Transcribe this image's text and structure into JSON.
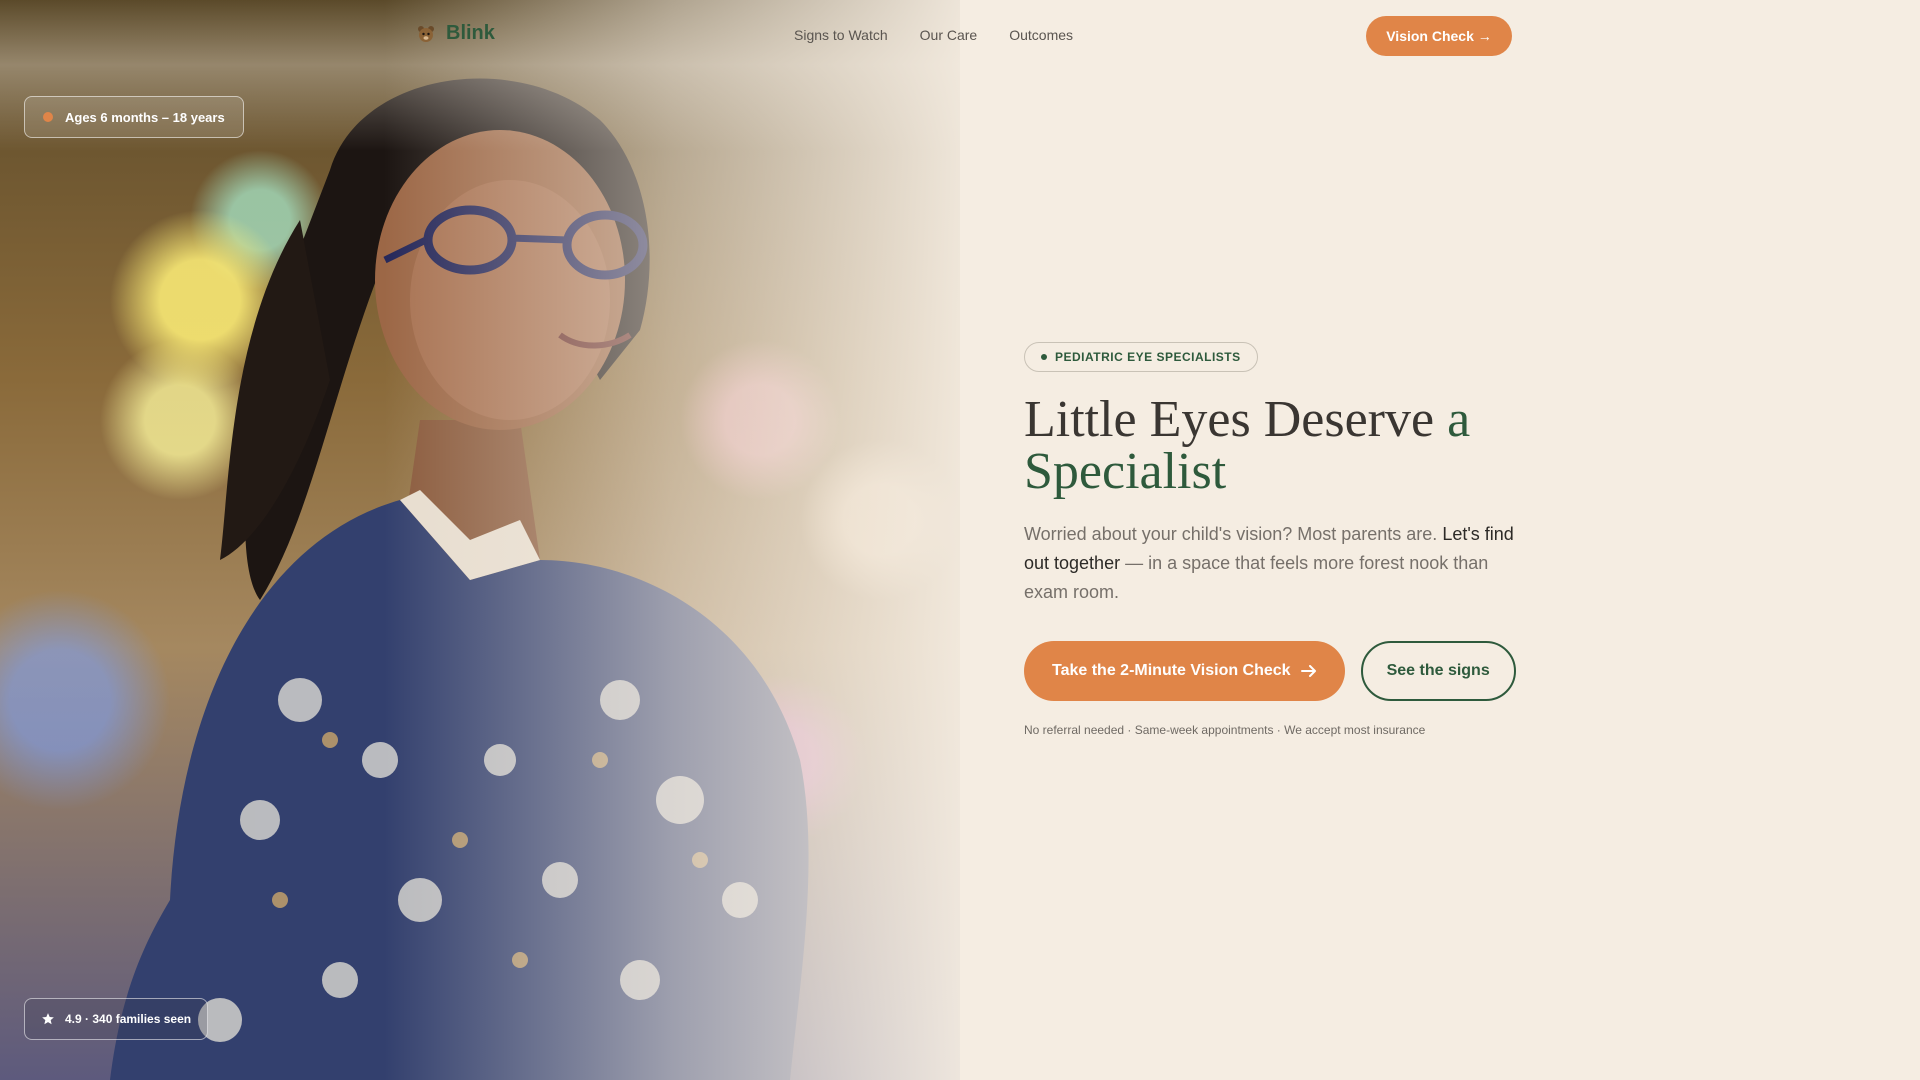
{
  "brand": {
    "name": "Blink",
    "logo_icon": "bear-cub-icon"
  },
  "nav": {
    "items": [
      {
        "label": "Signs to Watch"
      },
      {
        "label": "Our Care"
      },
      {
        "label": "Outcomes"
      }
    ],
    "cta_label": "Vision Check →"
  },
  "photo": {
    "ages_badge": "Ages 6 months – 18 years",
    "rating_badge": "4.9 · 340 families seen"
  },
  "hero": {
    "eyebrow": "PEDIATRIC EYE SPECIALISTS",
    "title_main": "Little Eyes Deserve ",
    "title_accent": "a Specialist",
    "lede_start": "Worried about your child's vision? Most parents are. ",
    "lede_emphasis": "Let's find out together",
    "lede_end": " — in a space that feels more forest nook than exam room.",
    "primary_label": "Take the 2-Minute Vision Check",
    "secondary_label": "See the signs",
    "fineprint": "No referral needed · Same-week appointments · We accept most insurance"
  },
  "colors": {
    "background": "#f5ede2",
    "accent_orange": "#e08548",
    "forest_green": "#2e5a3c",
    "text_dark": "#3a3632",
    "text_muted": "#76706a"
  }
}
